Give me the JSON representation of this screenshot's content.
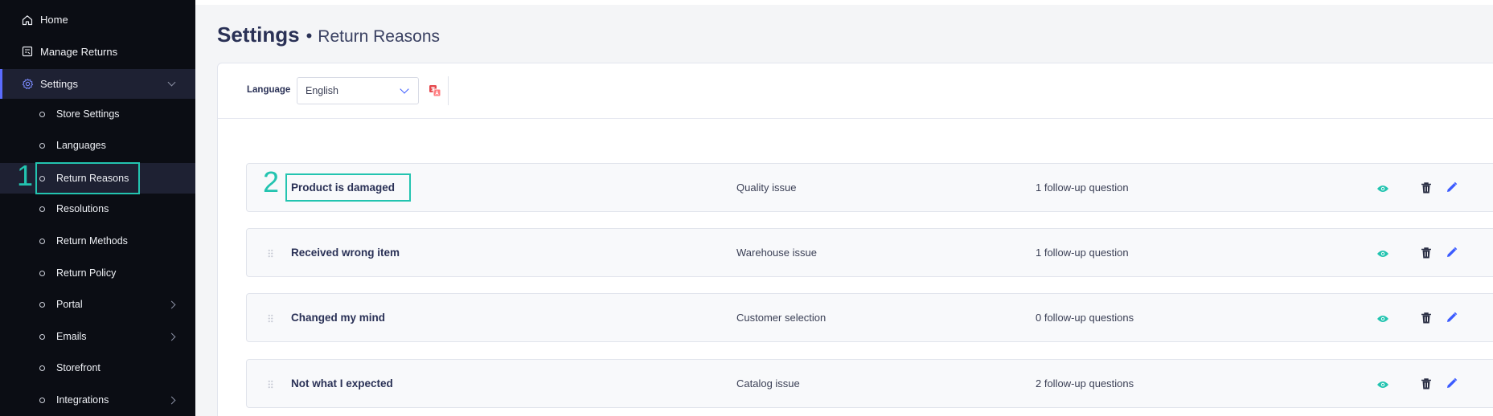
{
  "sidebar": {
    "items": [
      {
        "label": "Home",
        "icon": "home-icon"
      },
      {
        "label": "Manage Returns",
        "icon": "returns-icon"
      },
      {
        "label": "Settings",
        "icon": "gear-icon"
      }
    ],
    "settings_sub": [
      {
        "label": "Store Settings"
      },
      {
        "label": "Languages"
      },
      {
        "label": "Return Reasons"
      },
      {
        "label": "Resolutions"
      },
      {
        "label": "Return Methods"
      },
      {
        "label": "Return Policy"
      },
      {
        "label": "Portal"
      },
      {
        "label": "Emails"
      },
      {
        "label": "Storefront"
      },
      {
        "label": "Integrations"
      }
    ]
  },
  "annotations": {
    "first": "1",
    "second": "2"
  },
  "header": {
    "title": "Settings",
    "separator": "•",
    "subtitle": "Return Reasons"
  },
  "toolbar": {
    "language_label": "Language",
    "language_value": "English"
  },
  "reasons": [
    {
      "name": "Product is damaged",
      "category": "Quality issue",
      "followups": "1 follow-up question"
    },
    {
      "name": "Received wrong item",
      "category": "Warehouse issue",
      "followups": "1 follow-up question"
    },
    {
      "name": "Changed my mind",
      "category": "Customer selection",
      "followups": "0 follow-up questions"
    },
    {
      "name": "Not what I expected",
      "category": "Catalog issue",
      "followups": "2 follow-up questions"
    }
  ],
  "colors": {
    "accent": "#3b5bff",
    "teal": "#23c4b0",
    "sidebar_bg": "#0b0d14",
    "delete_red": "#e5484d"
  }
}
